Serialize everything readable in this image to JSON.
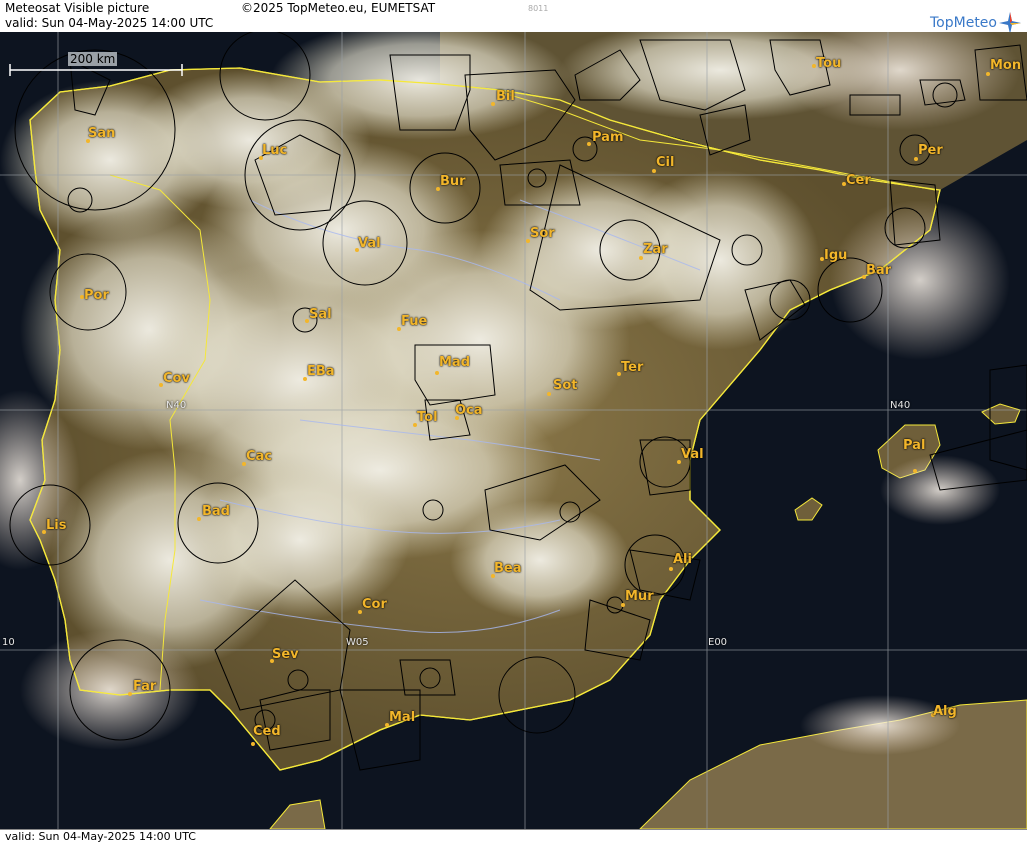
{
  "header": {
    "title": "Meteosat Visible picture",
    "valid": "valid:  Sun  04-May-2025  14:00 UTC",
    "copyright": "©2025 TopMeteo.eu, EUMETSAT",
    "code": "8011",
    "logo": "TopMeteo",
    "logo_icon": "compass-star-icon"
  },
  "footer": {
    "valid": "valid:  Sun  04-May-2025  14:00 UTC"
  },
  "scale": {
    "label": "200 km"
  },
  "grid": {
    "n40": "N40",
    "n40_east": "N40",
    "w05": "W05",
    "e00": "E00",
    "w10": "10"
  },
  "colors": {
    "city": "#f2b62b",
    "sea": "#0d1420",
    "land": "#6b5a35",
    "coast": "#f5e83a",
    "cloud": "#f2f0e6"
  },
  "cities": [
    {
      "label": "San"
    },
    {
      "label": "Luc"
    },
    {
      "label": "Bur"
    },
    {
      "label": "Bil"
    },
    {
      "label": "Pam"
    },
    {
      "label": "Cil"
    },
    {
      "label": "Tou"
    },
    {
      "label": "Mon"
    },
    {
      "label": "Per"
    },
    {
      "label": "Cer"
    },
    {
      "label": "Sor"
    },
    {
      "label": "Zar"
    },
    {
      "label": "Val"
    },
    {
      "label": "Por"
    },
    {
      "label": "Igu"
    },
    {
      "label": "Bar"
    },
    {
      "label": "Sal"
    },
    {
      "label": "Fue"
    },
    {
      "label": "Mad"
    },
    {
      "label": "Cov"
    },
    {
      "label": "EBa"
    },
    {
      "label": "Ter"
    },
    {
      "label": "Sot"
    },
    {
      "label": "Tol"
    },
    {
      "label": "Oca"
    },
    {
      "label": "Pal"
    },
    {
      "label": "Cac"
    },
    {
      "label": "Val"
    },
    {
      "label": "Lis"
    },
    {
      "label": "Bad"
    },
    {
      "label": "Ali"
    },
    {
      "label": "Bea"
    },
    {
      "label": "Mur"
    },
    {
      "label": "Cor"
    },
    {
      "label": "Sev"
    },
    {
      "label": "Far"
    },
    {
      "label": "Mal"
    },
    {
      "label": "Ced"
    },
    {
      "label": "Alg"
    }
  ]
}
